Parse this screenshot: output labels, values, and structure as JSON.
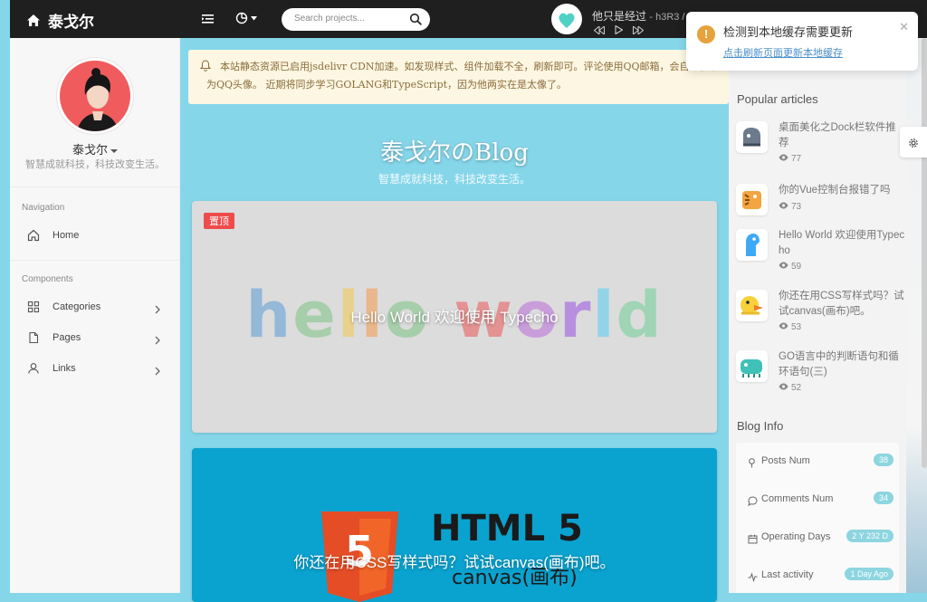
{
  "header": {
    "brand": "泰戈尔",
    "search_placeholder": "Search projects...",
    "player": {
      "song": "他只是经过",
      "artist": "- h3R3 /"
    }
  },
  "sidebar": {
    "user_name": "泰戈尔",
    "motto": "智慧成就科技，科技改变生活。",
    "nav_heading": "Navigation",
    "components_heading": "Components",
    "items": [
      {
        "label": "Home",
        "icon": "home-icon"
      },
      {
        "label": "Categories",
        "icon": "grid-icon"
      },
      {
        "label": "Pages",
        "icon": "file-icon"
      },
      {
        "label": "Links",
        "icon": "user-icon"
      }
    ]
  },
  "notice": {
    "text": "本站静态资源已启用jsdelivr CDN加速。如发现样式、组件加载不全，刷新即可。评论使用QQ邮箱，会自动获取为QQ头像。 近期将同步学习GOLANG和TypeScript，因为他两实在是太像了。"
  },
  "blog": {
    "title": "泰戈尔のBlog",
    "subtitle": "智慧成就科技，科技改变生活。"
  },
  "posts": [
    {
      "pin_label": "置顶",
      "title": "Hello World 欢迎使用 Typecho",
      "cover_text": "hello world"
    },
    {
      "title": "你还在用CSS写样式吗？试试canvas(画布)吧。",
      "cover_heading": "HTML 5",
      "cover_sub": "canvas(画布)"
    }
  ],
  "popular": {
    "heading": "Popular articles",
    "items": [
      {
        "title": "桌面美化之Dock栏软件推荐",
        "views": "77"
      },
      {
        "title": "你的Vue控制台报错了吗",
        "views": "73"
      },
      {
        "title": "Hello World 欢迎使用Typecho",
        "views": "59"
      },
      {
        "title": "你还在用CSS写样式吗？试试canvas(画布)吧。",
        "views": "53"
      },
      {
        "title": "GO语言中的判断语句和循环语句(三)",
        "views": "52"
      }
    ]
  },
  "blog_info": {
    "heading": "Blog Info",
    "rows": [
      {
        "label": "Posts Num",
        "value": "38"
      },
      {
        "label": "Comments Num",
        "value": "34"
      },
      {
        "label": "Operating Days",
        "value": "2 Y 232 D"
      },
      {
        "label": "Last activity",
        "value": "1 Day Ago"
      }
    ]
  },
  "toast": {
    "title": "检测到本地缓存需要更新",
    "link_prefix": "点击刷新页面",
    "link_suffix": "更新本地缓存"
  },
  "colors": {
    "accent_bg": "#86d6ea",
    "topbar": "#1f1f1f",
    "pin": "#ef4b4b",
    "warning": "#e6a23c",
    "badge": "#8dd5e0"
  }
}
